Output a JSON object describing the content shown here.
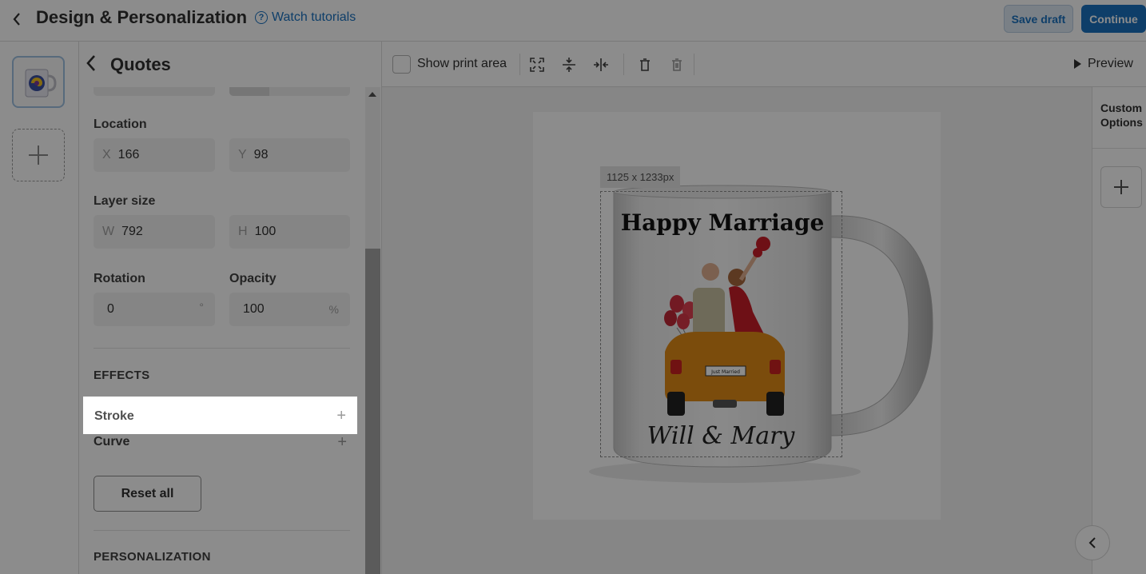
{
  "header": {
    "back_icon": "chevron-left-icon",
    "title": "Design & Personalization",
    "tutorials_label": "Watch tutorials",
    "save_draft_label": "Save draft",
    "continue_label": "Continue",
    "accent_color": "#1b72c0"
  },
  "left_rail": {
    "add_icon": "plus-icon"
  },
  "panel": {
    "title": "Quotes",
    "location_label": "Location",
    "x_prefix": "X",
    "x_value": "166",
    "y_prefix": "Y",
    "y_value": "98",
    "layer_size_label": "Layer size",
    "w_prefix": "W",
    "w_value": "792",
    "h_prefix": "H",
    "h_value": "100",
    "rotation_label": "Rotation",
    "rotation_value": "0",
    "rotation_unit": "°",
    "opacity_label": "Opacity",
    "opacity_value": "100",
    "opacity_unit": "%",
    "effects_heading": "EFFECTS",
    "effects": [
      {
        "label": "Stroke",
        "action_icon": "plus-icon"
      },
      {
        "label": "Curve",
        "action_icon": "plus-icon"
      }
    ],
    "reset_label": "Reset all",
    "personalization_heading": "PERSONALIZATION"
  },
  "toolbar": {
    "show_print_area_label": "Show print area",
    "show_print_area_checked": false,
    "icons": [
      "fit-screen-icon",
      "align-vertical-center-icon",
      "align-horizontal-center-icon",
      "delete-icon",
      "delete-all-icon"
    ],
    "preview_label": "Preview"
  },
  "canvas": {
    "dimensions_label": "1125 x 1233px",
    "design_text_top": "Happy Marriage",
    "design_text_bottom": "Will & Mary",
    "plate_text": "Just Married"
  },
  "right_rail": {
    "custom_options_label_1": "Custom",
    "custom_options_label_2": "Options",
    "add_icon": "plus-icon",
    "collapse_icon": "chevron-left-icon"
  }
}
